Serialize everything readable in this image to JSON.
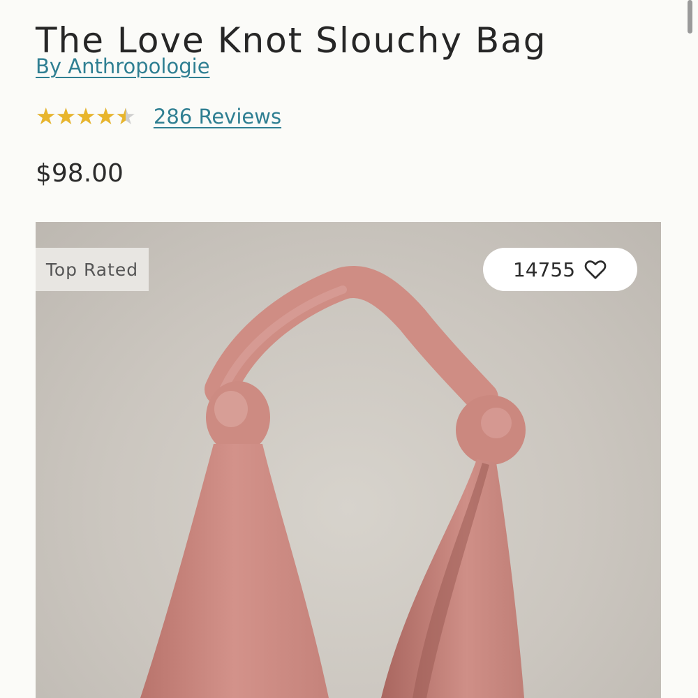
{
  "product": {
    "title": "The Love Knot Slouchy Bag",
    "brand_link": "By Anthropologie",
    "rating": 4.5,
    "rating_max": 5,
    "reviews_link": "286 Reviews",
    "price": "$98.00"
  },
  "image": {
    "badge": "Top Rated",
    "wishlist_count": "14755",
    "wishlist_icon": "heart-outline-icon"
  },
  "colors": {
    "link": "#2f7f92",
    "star": "#e8b52c",
    "bag": "#d08d84"
  }
}
